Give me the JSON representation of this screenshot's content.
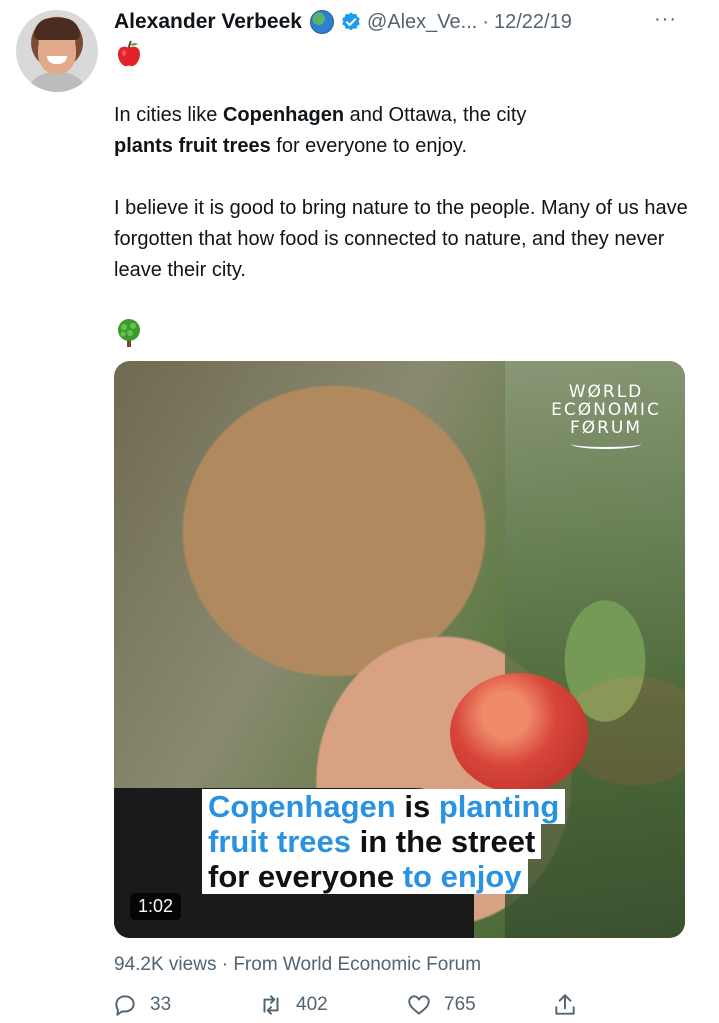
{
  "author": {
    "name": "Alexander Verbeek",
    "handle": "@Alex_Ve...",
    "separator": "·",
    "date": "12/22/19",
    "more_label": "···"
  },
  "tweet": {
    "line1_pre": "In cities like ",
    "line1_bold": "Copenhagen",
    "line1_post": " and Ottawa, the city",
    "line2_bold": "plants fruit trees",
    "line2_post": " for everyone to enjoy.",
    "para2": "I believe it is good to bring nature to the people. Many of us have forgotten that how food is connected to nature, and they never leave their city."
  },
  "media": {
    "logo_line1": "WØRLD",
    "logo_line2": "ECØNOMIC",
    "logo_line3": "FØRUM",
    "caption": {
      "l1_a": "Copenhagen",
      "l1_b": " is ",
      "l1_c": "planting",
      "l2_a": "fruit trees",
      "l2_b": " in the street",
      "l3_a": "for everyone ",
      "l3_b": "to enjoy"
    },
    "duration": "1:02"
  },
  "stats": {
    "views_line": "94.2K views · From World Economic Forum"
  },
  "actions": {
    "replies": "33",
    "retweets": "402",
    "likes": "765"
  },
  "icons": [
    "globe-icon",
    "verified-badge-icon",
    "more-icon",
    "apple-emoji-icon",
    "tree-emoji-icon",
    "reply-icon",
    "retweet-icon",
    "like-icon",
    "share-icon"
  ],
  "colors": {
    "text": "#0f1419",
    "secondary": "#536471",
    "verified": "#1d9bf0",
    "caption_blue": "#2b92e0"
  }
}
